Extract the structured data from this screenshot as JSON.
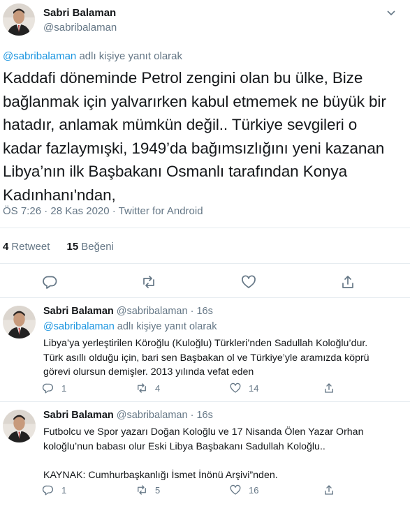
{
  "main": {
    "name": "Sabri Balaman",
    "handle": "@sabribalaman",
    "reply_to_user": "@sabribalaman",
    "reply_to_suffix": " adlı kişiye yanıt olarak",
    "text_lines": [
      "Kaddafi döneminde Petrol zengini olan bu ülke, Bize",
      "bağlanmak için yalvarırken kabul etmemek ne büyük bir",
      "hatadır, anlamak mümkün değil.. Türkiye sevgileri o",
      "kadar fazlaymışki, 1949’da bağımsızlığını yeni kazanan",
      "Libya’nın ilk Başbakanı Osmanlı tarafından Konya",
      "Kadınhanı'ndan,"
    ],
    "meta": "ÖS 7:26 · 28 Kas 2020 · Twitter for Android",
    "retweets_count": "4",
    "retweets_label": "Retweet",
    "likes_count": "15",
    "likes_label": "Beğeni",
    "actions": [
      "reply-icon",
      "retweet-icon",
      "like-icon",
      "share-icon"
    ]
  },
  "replies": [
    {
      "name": "Sabri Balaman",
      "handle": "@sabribalaman",
      "time": "· 16s",
      "reply_to_user": "@sabribalaman",
      "reply_to_suffix": " adlı kişiye yanıt olarak",
      "body": "Libya’ya yerleştirilen Köroğlu (Kuloğlu) Türkleri’nden Sadullah Koloğlu’dur.\nTürk asıllı olduğu için, bari sen Başbakan ol ve Türkiye’yle aramızda köprü\ngörevi olursun demişler. 2013 yılında vefat eden",
      "reply_count": "1",
      "retweet_count": "4",
      "like_count": "14"
    },
    {
      "name": "Sabri Balaman",
      "handle": "@sabribalaman",
      "time": "· 16s",
      "body": "Futbolcu ve Spor yazarı Doğan Koloğlu ve 17 Nisanda Ölen Yazar Orhan\nkoloğlu’nun babası olur Eski Libya Başbakanı Sadullah Koloğlu..\n\nKAYNAK: Cumhurbaşkanlığı İsmet İnönü Arşivi”nden.",
      "reply_count": "1",
      "retweet_count": "5",
      "like_count": "16"
    }
  ],
  "colors": {
    "link": "#1b95e0",
    "muted": "#657786",
    "text": "#14171a",
    "border": "#e6ecf0"
  }
}
